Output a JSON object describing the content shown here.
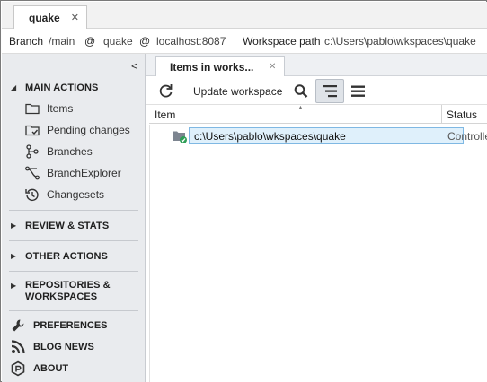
{
  "top_tab": {
    "label": "quake",
    "close": "✕"
  },
  "info_bar": {
    "branch_label": "Branch",
    "branch_value": "/main",
    "at1": "@",
    "repo": "quake",
    "at2": "@",
    "server": "localhost:8087",
    "workspace_label": "Workspace path",
    "workspace_value": "c:\\Users\\pablo\\wkspaces\\quake"
  },
  "sidebar": {
    "collapse": "<",
    "main_actions": {
      "title": "MAIN ACTIONS",
      "items": [
        {
          "label": "Items",
          "icon": "folder-icon"
        },
        {
          "label": "Pending changes",
          "icon": "pending-changes-icon"
        },
        {
          "label": "Branches",
          "icon": "branches-icon"
        },
        {
          "label": "BranchExplorer",
          "icon": "branch-explorer-icon"
        },
        {
          "label": "Changesets",
          "icon": "history-icon"
        }
      ]
    },
    "sections": [
      {
        "title": "REVIEW & STATS"
      },
      {
        "title": "OTHER ACTIONS"
      },
      {
        "title_line1": "REPOSITORIES &",
        "title_line2": "WORKSPACES"
      }
    ],
    "bottom": [
      {
        "label": "PREFERENCES",
        "icon": "wrench-icon"
      },
      {
        "label": "BLOG NEWS",
        "icon": "rss-icon"
      },
      {
        "label": "ABOUT",
        "icon": "about-icon"
      }
    ]
  },
  "main": {
    "tab": {
      "label": "Items in works...",
      "close": "✕"
    },
    "toolbar": {
      "update_label": "Update workspace"
    },
    "grid": {
      "columns": [
        "Item",
        "Status"
      ],
      "rows": [
        {
          "item": "c:\\Users\\pablo\\wkspaces\\quake",
          "status": "Controlled"
        }
      ]
    }
  },
  "colors": {
    "sidebar_bg": "#e9ebee",
    "selection_bg": "#dff0fb",
    "selection_border": "#7fb8e3",
    "checked_green": "#2e9e57"
  }
}
